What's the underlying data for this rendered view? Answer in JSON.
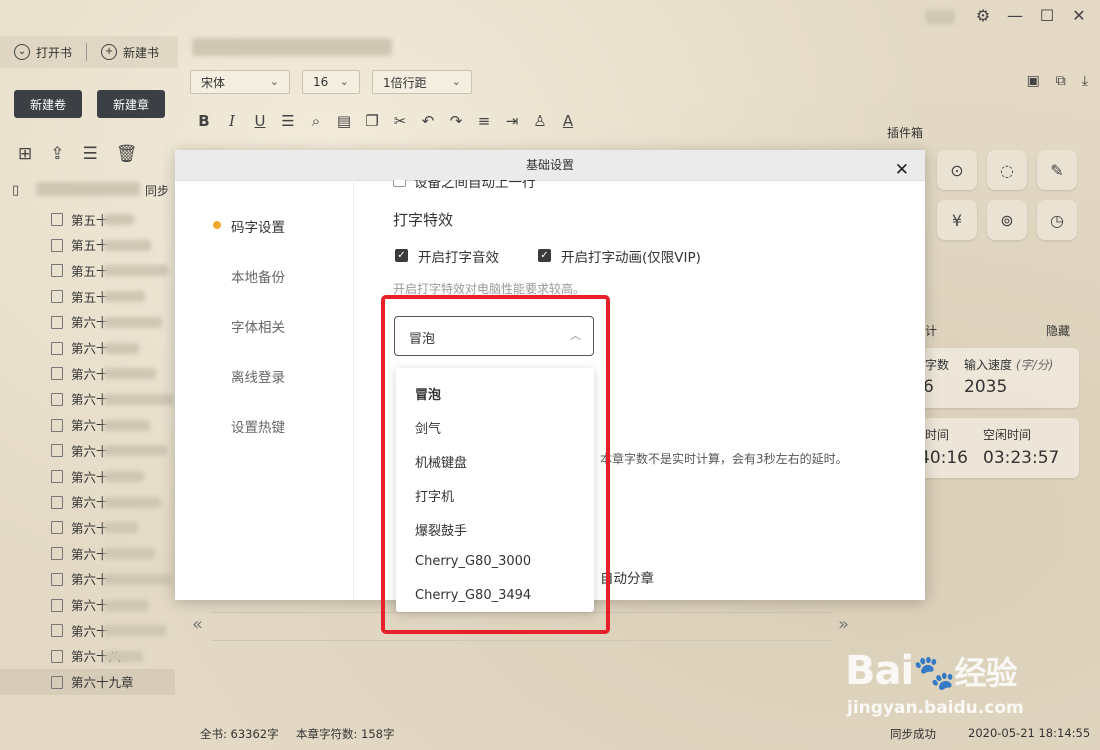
{
  "window": {
    "settings_icon": "gear-icon",
    "minimize_icon": "minimize-icon",
    "maximize_icon": "maximize-icon",
    "close_icon": "close-icon"
  },
  "left": {
    "open_book": "打开书",
    "new_book": "新建书",
    "new_volume": "新建卷",
    "new_chapter": "新建章",
    "sync": "同步",
    "chapters": [
      "第五十",
      "第五十",
      "第五十",
      "第五十",
      "第六十",
      "第六十",
      "第六十",
      "第六十",
      "第六十",
      "第六十",
      "第六十",
      "第六十",
      "第六十",
      "第六十",
      "第六十",
      "第六十",
      "第六十",
      "第六十八",
      "第六十九章"
    ]
  },
  "toolbar": {
    "font": "宋体",
    "size": "16",
    "line_spacing": "1倍行距"
  },
  "right": {
    "plugin_box": "插件箱",
    "stats_suffix": "计",
    "hide": "隐藏",
    "word_count_label": "字数",
    "typing_speed_label": "输入速度",
    "typing_speed_unit": "(字/分)",
    "word_count_value": "6",
    "typing_speed_value": "2035",
    "time_label": "时间",
    "idle_label": "空闲时间",
    "time_value": "40:16",
    "idle_value": "03:23:57"
  },
  "status": {
    "total": "全书: 63362字",
    "chapter": "本章字符数: 158字",
    "sync": "同步成功",
    "datetime": "2020-05-21 18:14:55"
  },
  "modal": {
    "title": "基础设置",
    "nav": [
      "码字设置",
      "本地备份",
      "字体相关",
      "离线登录",
      "设置热键"
    ],
    "truncated_top": "设备之间自动上一行",
    "section_title": "打字特效",
    "opt_sound": "开启打字音效",
    "opt_anim": "开启打字动画(仅限VIP)",
    "hint": "开启打字特效对电脑性能要求较高。",
    "selected_effect": "冒泡",
    "note": "本章字数不是实时计算，会有3秒左右的延时。",
    "auto_split": "自动分章"
  },
  "dropdown": {
    "items": [
      "冒泡",
      "剑气",
      "机械键盘",
      "打字机",
      "爆裂鼓手",
      "Cherry_G80_3000",
      "Cherry_G80_3494"
    ]
  },
  "watermark": {
    "brand": "Bai",
    "brand2": "经验",
    "url": "jingyan.baidu.com"
  },
  "colors": {
    "accent_dot": "#f0a92b",
    "highlight_red": "#e8202a",
    "dark_button": "#3c3f44"
  }
}
